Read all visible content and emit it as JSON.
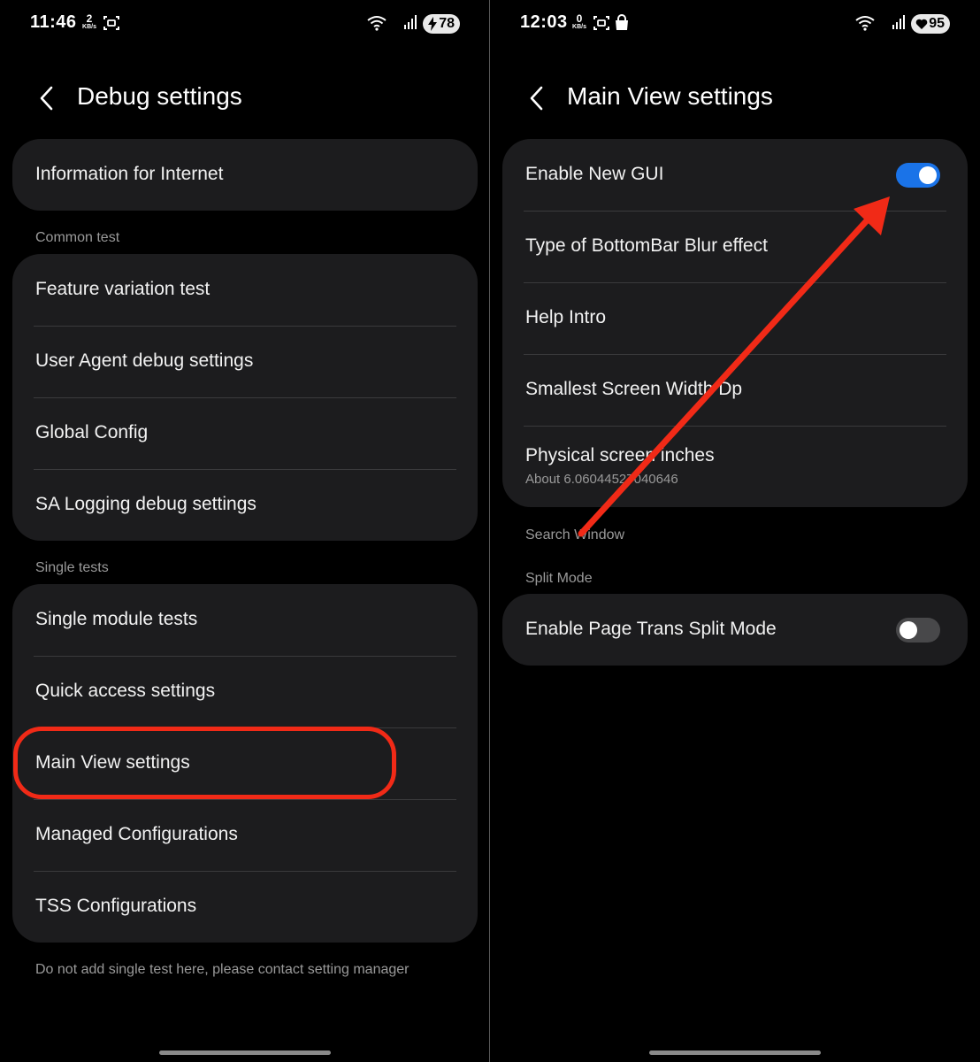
{
  "left": {
    "status": {
      "time": "11:46",
      "net_speed_value": "2",
      "net_speed_unit": "KB/s",
      "battery": "78"
    },
    "title": "Debug settings",
    "top_card": {
      "items": [
        {
          "label": "Information for Internet"
        }
      ]
    },
    "common_test": {
      "header": "Common test",
      "items": [
        {
          "label": "Feature variation test"
        },
        {
          "label": "User Agent debug settings"
        },
        {
          "label": "Global Config"
        },
        {
          "label": "SA Logging debug settings"
        }
      ]
    },
    "single_tests": {
      "header": "Single tests",
      "items": [
        {
          "label": "Single module tests"
        },
        {
          "label": "Quick access settings"
        },
        {
          "label": "Main View settings"
        },
        {
          "label": "Managed Configurations"
        },
        {
          "label": "TSS Configurations"
        }
      ]
    },
    "footer_note": "Do not add single test here, please contact setting manager"
  },
  "right": {
    "status": {
      "time": "12:03",
      "net_speed_value": "0",
      "net_speed_unit": "KB/s",
      "battery": "95"
    },
    "title": "Main View settings",
    "main_card": {
      "items": [
        {
          "label": "Enable New GUI",
          "toggle": true
        },
        {
          "label": "Type of BottomBar Blur effect"
        },
        {
          "label": "Help Intro"
        },
        {
          "label": "Smallest Screen Width Dp"
        },
        {
          "label": "Physical screen inches",
          "subtitle": "About 6.06044527040646"
        }
      ]
    },
    "search_window_header": "Search Window",
    "split_mode": {
      "header": "Split Mode",
      "items": [
        {
          "label": "Enable Page Trans Split Mode",
          "toggle": false
        }
      ]
    }
  },
  "colors": {
    "background": "#000000",
    "card": "#1c1c1e",
    "toggle_on": "#1a73e8",
    "annotation": "#f12a17"
  },
  "icons": [
    "back-arrow-icon",
    "screenshot-icon",
    "shopping-bag-icon",
    "wifi-icon",
    "signal-icon",
    "charging-bolt-icon",
    "heart-icon"
  ]
}
